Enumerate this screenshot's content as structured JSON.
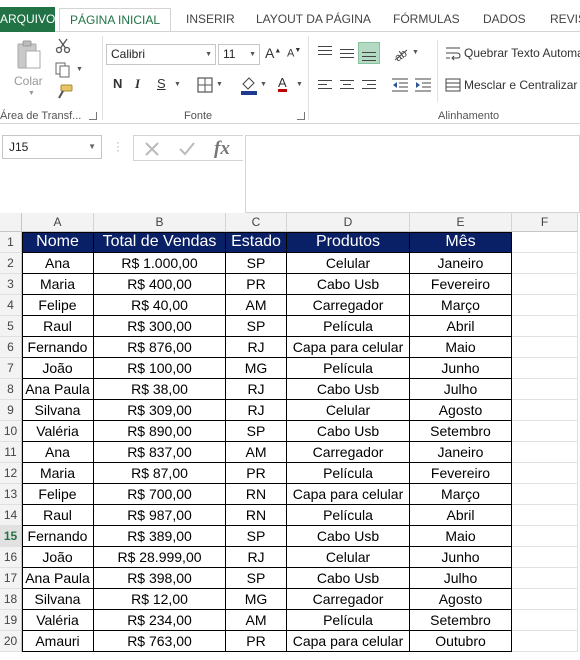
{
  "ribbon": {
    "tabs": [
      "ARQUIVO",
      "PÁGINA INICIAL",
      "INSERIR",
      "LAYOUT DA PÁGINA",
      "FÓRMULAS",
      "DADOS",
      "REVIS"
    ],
    "clipboard": {
      "paste_label": "Colar",
      "group_label": "Área de Transf..."
    },
    "font": {
      "name": "Calibri",
      "size": "11",
      "group_label": "Fonte",
      "bold": "N",
      "italic": "I",
      "underline": "S"
    },
    "alignment": {
      "wrap_text": "Quebrar Texto Automa",
      "merge_center": "Mesclar e Centralizar",
      "group_label": "Alinhamento"
    }
  },
  "formula_bar": {
    "name_box": "J15",
    "formula": ""
  },
  "grid": {
    "columns": [
      "A",
      "B",
      "C",
      "D",
      "E",
      "F"
    ],
    "selected_row": 15,
    "rows": [
      {
        "n": "1",
        "cells": [
          "Nome",
          "Total de Vendas",
          "Estado",
          "Produtos",
          "Mês"
        ]
      },
      {
        "n": "2",
        "cells": [
          "Ana",
          "R$ 1.000,00",
          "SP",
          "Celular",
          "Janeiro"
        ]
      },
      {
        "n": "3",
        "cells": [
          "Maria",
          "R$ 400,00",
          "PR",
          "Cabo Usb",
          "Fevereiro"
        ]
      },
      {
        "n": "4",
        "cells": [
          "Felipe",
          "R$ 40,00",
          "AM",
          "Carregador",
          "Março"
        ]
      },
      {
        "n": "5",
        "cells": [
          "Raul",
          "R$ 300,00",
          "SP",
          "Película",
          "Abril"
        ]
      },
      {
        "n": "6",
        "cells": [
          "Fernando",
          "R$ 876,00",
          "RJ",
          "Capa para celular",
          "Maio"
        ]
      },
      {
        "n": "7",
        "cells": [
          "João",
          "R$ 100,00",
          "MG",
          "Película",
          "Junho"
        ]
      },
      {
        "n": "8",
        "cells": [
          "Ana Paula",
          "R$ 38,00",
          "RJ",
          "Cabo Usb",
          "Julho"
        ]
      },
      {
        "n": "9",
        "cells": [
          "Silvana",
          "R$ 309,00",
          "RJ",
          "Celular",
          "Agosto"
        ]
      },
      {
        "n": "10",
        "cells": [
          "Valéria",
          "R$ 890,00",
          "SP",
          "Cabo Usb",
          "Setembro"
        ]
      },
      {
        "n": "11",
        "cells": [
          "Ana",
          "R$ 837,00",
          "AM",
          "Carregador",
          "Janeiro"
        ]
      },
      {
        "n": "12",
        "cells": [
          "Maria",
          "R$ 87,00",
          "PR",
          "Película",
          "Fevereiro"
        ]
      },
      {
        "n": "13",
        "cells": [
          "Felipe",
          "R$ 700,00",
          "RN",
          "Capa para celular",
          "Março"
        ]
      },
      {
        "n": "14",
        "cells": [
          "Raul",
          "R$ 987,00",
          "RN",
          "Película",
          "Abril"
        ]
      },
      {
        "n": "15",
        "cells": [
          "Fernando",
          "R$ 389,00",
          "SP",
          "Cabo Usb",
          "Maio"
        ]
      },
      {
        "n": "16",
        "cells": [
          "João",
          "R$ 28.999,00",
          "RJ",
          "Celular",
          "Junho"
        ]
      },
      {
        "n": "17",
        "cells": [
          "Ana Paula",
          "R$ 398,00",
          "SP",
          "Cabo Usb",
          "Julho"
        ]
      },
      {
        "n": "18",
        "cells": [
          "Silvana",
          "R$ 12,00",
          "MG",
          "Carregador",
          "Agosto"
        ]
      },
      {
        "n": "19",
        "cells": [
          "Valéria",
          "R$ 234,00",
          "AM",
          "Película",
          "Setembro"
        ]
      },
      {
        "n": "20",
        "cells": [
          "Amauri",
          "R$ 763,00",
          "PR",
          "Capa para celular",
          "Outubro"
        ]
      }
    ]
  },
  "colors": {
    "accent": "#217346",
    "header_fill": "#0a2066",
    "header_text": "#ffffff",
    "selected_align": "#b4dac3"
  }
}
